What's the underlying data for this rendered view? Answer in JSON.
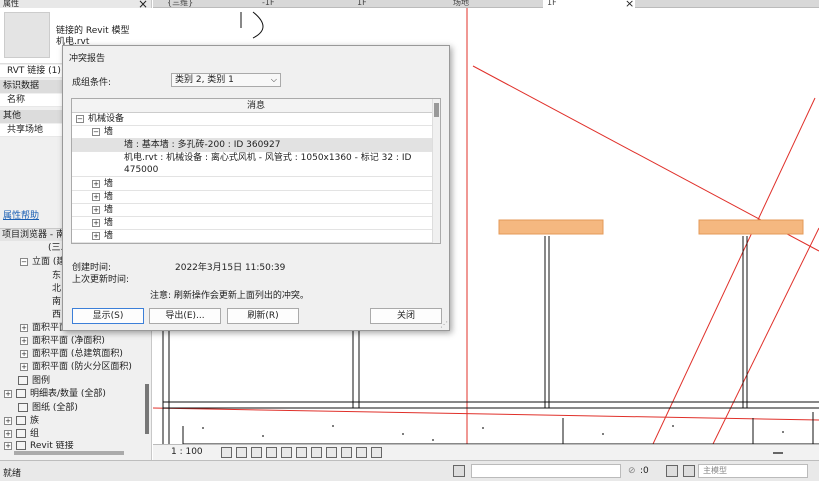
{
  "properties": {
    "title": "属性",
    "linked_name": "链接的 Revit 模型",
    "linked_file": "机电.rvt",
    "type": "RVT 链接 (1)",
    "section_ident": "标识数据",
    "field_name": "名称",
    "section_other": "其他",
    "shared_site": "共享场地",
    "help": "属性帮助"
  },
  "browser": {
    "title": "项目浏览器 - 南...",
    "items": [
      "(三...",
      "立面 (建...",
      "东",
      "北",
      "南",
      "西",
      "面积平面 (人防分区...",
      "面积平面 (净面积)",
      "面积平面 (总建筑面积)",
      "面积平面 (防火分区面积)",
      "图例",
      "明细表/数量 (全部)",
      "图纸 (全部)",
      "族",
      "组",
      "Revit 链接"
    ]
  },
  "tabs": [
    "{三维}",
    "-1F",
    "1F",
    "场地",
    "1F"
  ],
  "dialog": {
    "title": "冲突报告",
    "group_label": "成组条件:",
    "group_value": "类别 2, 类别 1",
    "list_header": "消息",
    "rows": [
      "机械设备",
      "墙",
      "墙 : 基本墙 : 多孔砖-200 : ID 360927",
      "机电.rvt : 机械设备 : 离心式风机 - 风管式 : 1050x1360 - 标记 32 : ID 475000",
      "墙",
      "墙",
      "墙",
      "墙",
      "墙"
    ],
    "created_label": "创建时间:",
    "created_value": "2022年3月15日 11:50:39",
    "updated_label": "上次更新时间:",
    "note": "注意: 刷新操作会更新上面列出的冲突。",
    "btn_show": "显示(S)",
    "btn_export": "导出(E)...",
    "btn_refresh": "刷新(R)",
    "btn_close": "关闭"
  },
  "viewbar": {
    "scale": "1 : 100"
  },
  "status": {
    "text": "就绪",
    "zero": ":0",
    "model": "主模型"
  },
  "colors": {
    "accent": "#3c7fd8",
    "beam": "#f5b880",
    "redline": "#e0302a"
  }
}
